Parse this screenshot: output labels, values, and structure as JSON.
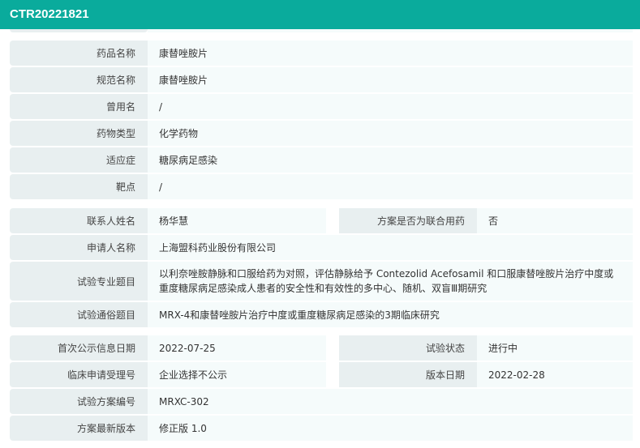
{
  "title": "CTR20221821",
  "drug": [
    {
      "label": "药品名称",
      "value": "康替唑胺片"
    },
    {
      "label": "规范名称",
      "value": "康替唑胺片"
    },
    {
      "label": "曾用名",
      "value": "/"
    },
    {
      "label": "药物类型",
      "value": "化学药物"
    },
    {
      "label": "适应症",
      "value": "糖尿病足感染"
    },
    {
      "label": "靶点",
      "value": "/"
    }
  ],
  "trial": {
    "contact": {
      "label": "联系人姓名",
      "value": "杨华慧"
    },
    "combo": {
      "label": "方案是否为联合用药",
      "value": "否"
    },
    "applicant": {
      "label": "申请人名称",
      "value": "上海盟科药业股份有限公司"
    },
    "pro_title": {
      "label": "试验专业题目",
      "value": "以利奈唑胺静脉和口服给药为对照，评估静脉给予 Contezolid Acefosamil 和口服康替唑胺片治疗中度或重度糖尿病足感染成人患者的安全性和有效性的多中心、随机、双盲Ⅲ期研究"
    },
    "pop_title": {
      "label": "试验通俗题目",
      "value": "MRX-4和康替唑胺片治疗中度或重度糖尿病足感染的3期临床研究"
    }
  },
  "info": {
    "first_date": {
      "label": "首次公示信息日期",
      "value": "2022-07-25"
    },
    "status": {
      "label": "试验状态",
      "value": "进行中"
    },
    "accept_no": {
      "label": "临床申请受理号",
      "value": "企业选择不公示"
    },
    "version_date": {
      "label": "版本日期",
      "value": "2022-02-28"
    },
    "protocol_no": {
      "label": "试验方案编号",
      "value": "MRXC-302"
    },
    "protocol_ver": {
      "label": "方案最新版本",
      "value": "修正版 1.0"
    }
  }
}
